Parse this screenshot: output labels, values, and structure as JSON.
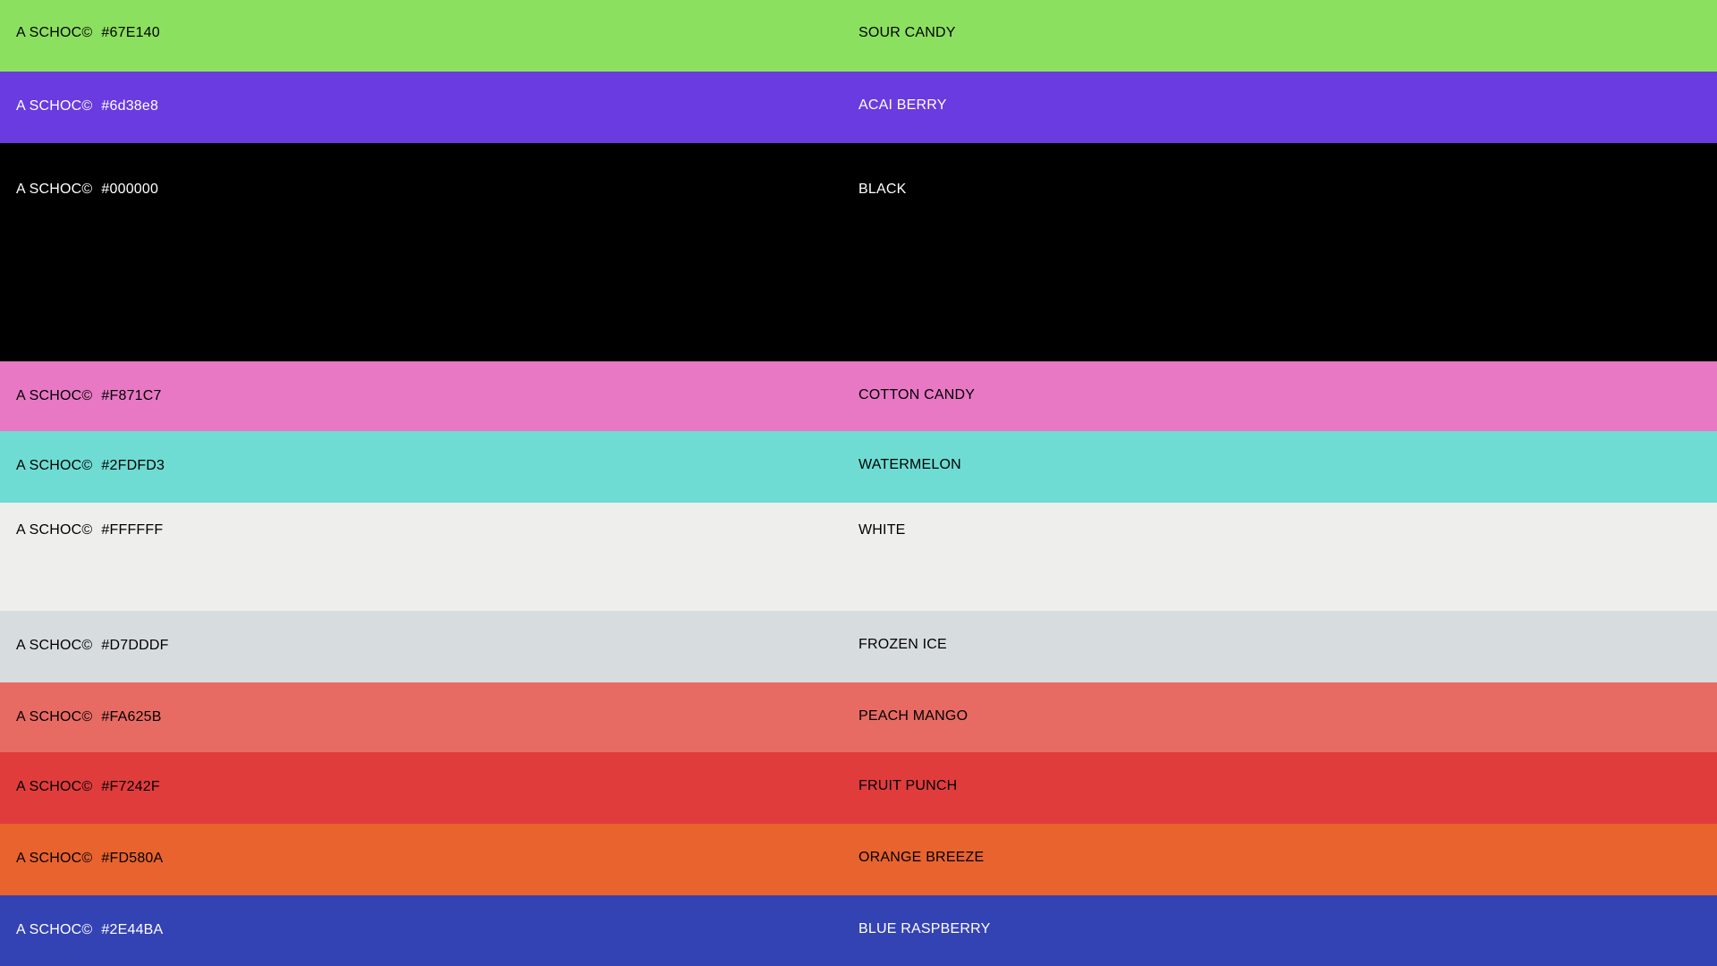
{
  "swatches": [
    {
      "brand": "A SCHOC©",
      "code": "#67E140",
      "name": "SOUR CANDY",
      "color": "#8CE060"
    },
    {
      "brand": "A SCHOC©",
      "code": "#6d38e8",
      "name": "ACAI BERRY",
      "color": "#6A3BE0"
    },
    {
      "brand": "A SCHOC©",
      "code": "#000000",
      "name": "BLACK",
      "color": "#000000"
    },
    {
      "brand": "A SCHOC©",
      "code": "#F871C7",
      "name": "COTTON CANDY",
      "color": "#E878C4"
    },
    {
      "brand": "A SCHOC©",
      "code": "#2FDFD3",
      "name": "WATERMELON",
      "color": "#6FDCD3"
    },
    {
      "brand": "A SCHOC©",
      "code": "#FFFFFF",
      "name": "WHITE",
      "color": "#EEEEEC"
    },
    {
      "brand": "A SCHOC©",
      "code": "#D7DDDF",
      "name": "FROZEN ICE",
      "color": "#D7DCDF"
    },
    {
      "brand": "A SCHOC©",
      "code": "#FA625B",
      "name": "PEACH MANGO",
      "color": "#E86B63"
    },
    {
      "brand": "A SCHOC©",
      "code": "#F7242F",
      "name": "FRUIT PUNCH",
      "color": "#E13C3C"
    },
    {
      "brand": "A SCHOC©",
      "code": "#FD580A",
      "name": "ORANGE BREEZE",
      "color": "#E9632F"
    },
    {
      "brand": "A SCHOC©",
      "code": "#2E44BA",
      "name": "BLUE RASPBERRY",
      "color": "#3343B4"
    }
  ]
}
